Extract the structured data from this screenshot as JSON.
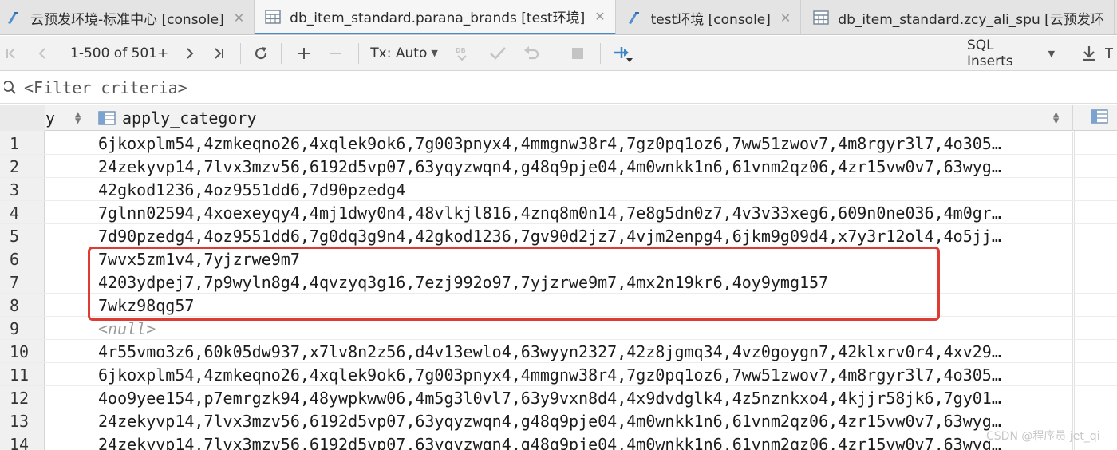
{
  "tabs": [
    {
      "label": "云预发环境-标准中心 [console]",
      "icon": "console-icon",
      "active": false
    },
    {
      "label": "db_item_standard.parana_brands [test环境]",
      "icon": "table-icon",
      "active": true
    },
    {
      "label": "test环境 [console]",
      "icon": "console-icon",
      "active": false
    },
    {
      "label": "db_item_standard.zcy_ali_spu [云预发环",
      "icon": "table-icon",
      "active": false
    }
  ],
  "toolbar": {
    "page_info": "1-500 of 501+",
    "tx_mode": "Tx: Auto",
    "export_format": "SQL Inserts"
  },
  "filter": {
    "placeholder": "<Filter criteria>"
  },
  "columns": {
    "prev_partial": "y",
    "main": "apply_category"
  },
  "rows": [
    {
      "num": "1",
      "value": "6jkoxplm54,4zmkeqno26,4xqlek9ok6,7g003pnyx4,4mmgnw38r4,7gz0pq1oz6,7ww51zwov7,4m8rgyr3l7,4o305…"
    },
    {
      "num": "2",
      "value": "24zekyvp14,7lvx3mzv56,6192d5vp07,63yqyzwqn4,g48q9pje04,4m0wnkk1n6,61vnm2qz06,4zr15vw0v7,63wyg…"
    },
    {
      "num": "3",
      "value": "42gkod1236,4oz9551dd6,7d90pzedg4"
    },
    {
      "num": "4",
      "value": "7glnn02594,4xoexeyqy4,4mj1dwy0n4,48vlkjl816,4znq8m0n14,7e8g5dn0z7,4v3v33xeg6,609n0ne036,4m0gr…"
    },
    {
      "num": "5",
      "value": "7d90pzedg4,4oz9551dd6,7g0dq3g9n4,42gkod1236,7gv90d2jz7,4vjm2enpg4,6jkm9g09d4,x7y3r12ol4,4o5jj…"
    },
    {
      "num": "6",
      "value": "7wvx5zm1v4,7yjzrwe9m7"
    },
    {
      "num": "7",
      "value": "4203ydpej7,7p9wyln8g4,4qvzyq3g16,7ezj992o97,7yjzrwe9m7,4mx2n19kr6,4oy9ymg157"
    },
    {
      "num": "8",
      "value": "7wkz98qg57"
    },
    {
      "num": "9",
      "value": "<null>",
      "null": true
    },
    {
      "num": "10",
      "value": "4r55vmo3z6,60k05dw937,x7lv8n2z56,d4v13ewlo4,63wyyn2327,42z8jgmq34,4vz0goygn7,42klxrv0r4,4xv29…"
    },
    {
      "num": "11",
      "value": "6jkoxplm54,4zmkeqno26,4xqlek9ok6,7g003pnyx4,4mmgnw38r4,7gz0pq1oz6,7ww51zwov7,4m8rgyr3l7,4o305…"
    },
    {
      "num": "12",
      "value": "4oo9yee154,p7emrgzk94,48ywpkww06,4m5g3l0vl7,63y9vxn8d4,4x9dvdglk4,4z5nznkxo4,4kjjr58jk6,7gy01…"
    },
    {
      "num": "13",
      "value": "24zekyvp14,7lvx3mzv56,6192d5vp07,63yqyzwqn4,g48q9pje04,4m0wnkk1n6,61vnm2qz06,4zr15vw0v7,63wyg…"
    },
    {
      "num": "14",
      "value": "24zekyvp14,7lvx3mzv56,6192d5vp07,63yqyzwqn4,g48q9pje04,4m0wnkk1n6,61vnm2qz06,4zr15vw0v7,63wyg…"
    }
  ],
  "watermark": "CSDN @程序员 jet_qi",
  "colors": {
    "highlight": "#de3b32",
    "active_tab_underline": "#4a88c7",
    "null_text": "#9a9a9a"
  }
}
